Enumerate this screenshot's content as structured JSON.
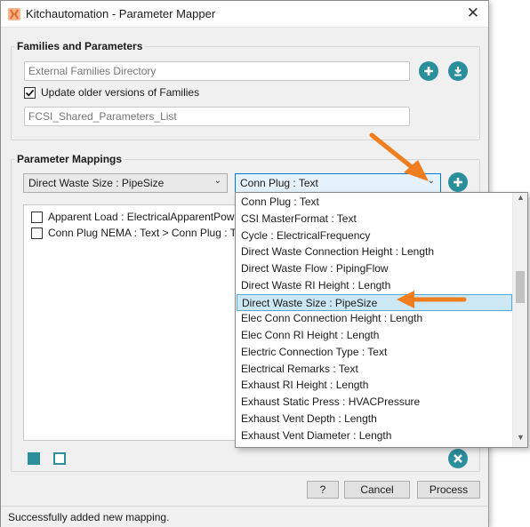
{
  "window": {
    "title": "Kitchautomation - Parameter Mapper"
  },
  "families": {
    "group_title": "Families and Parameters",
    "directory_placeholder": "External Families Directory",
    "update_checkbox_label": "Update older versions of Families",
    "update_checked": true,
    "shared_params_placeholder": "FCSI_Shared_Parameters_List"
  },
  "mappings": {
    "group_title": "Parameter Mappings",
    "left_combo_value": "Direct Waste Size : PipeSize",
    "right_combo_value": "Conn Plug : Text",
    "items": [
      {
        "label": "Apparent Load : ElectricalApparentPower >",
        "checked": false
      },
      {
        "label": "Conn Plug NEMA : Text > Conn Plug : Text",
        "checked": false
      }
    ]
  },
  "dropdown": {
    "options": [
      "Conn Plug : Text",
      "CSI MasterFormat : Text",
      "Cycle : ElectricalFrequency",
      "Direct Waste Connection Height : Length",
      "Direct Waste Flow : PipingFlow",
      "Direct Waste RI Height : Length",
      "Direct Waste Size : PipeSize",
      "Elec Conn Connection Height : Length",
      "Elec Conn RI Height : Length",
      "Electric Connection Type : Text",
      "Electrical Remarks : Text",
      "Exhaust RI Height : Length",
      "Exhaust Static Press : HVACPressure",
      "Exhaust Vent Depth : Length",
      "Exhaust Vent Diameter : Length"
    ],
    "selected_index": 6
  },
  "buttons": {
    "help_label": "?",
    "cancel_label": "Cancel",
    "process_label": "Process"
  },
  "status": {
    "text": "Successfully added new mapping."
  },
  "colors": {
    "accent": "#2b8e9b",
    "annotation_arrow": "#f07d1e",
    "selection_bg": "#cce8f4",
    "selection_border": "#54a8d6"
  },
  "icons": {
    "app": "kitchautomation-logo-icon",
    "add": "plus-circle-icon",
    "download": "download-circle-icon",
    "remove": "x-circle-icon"
  }
}
